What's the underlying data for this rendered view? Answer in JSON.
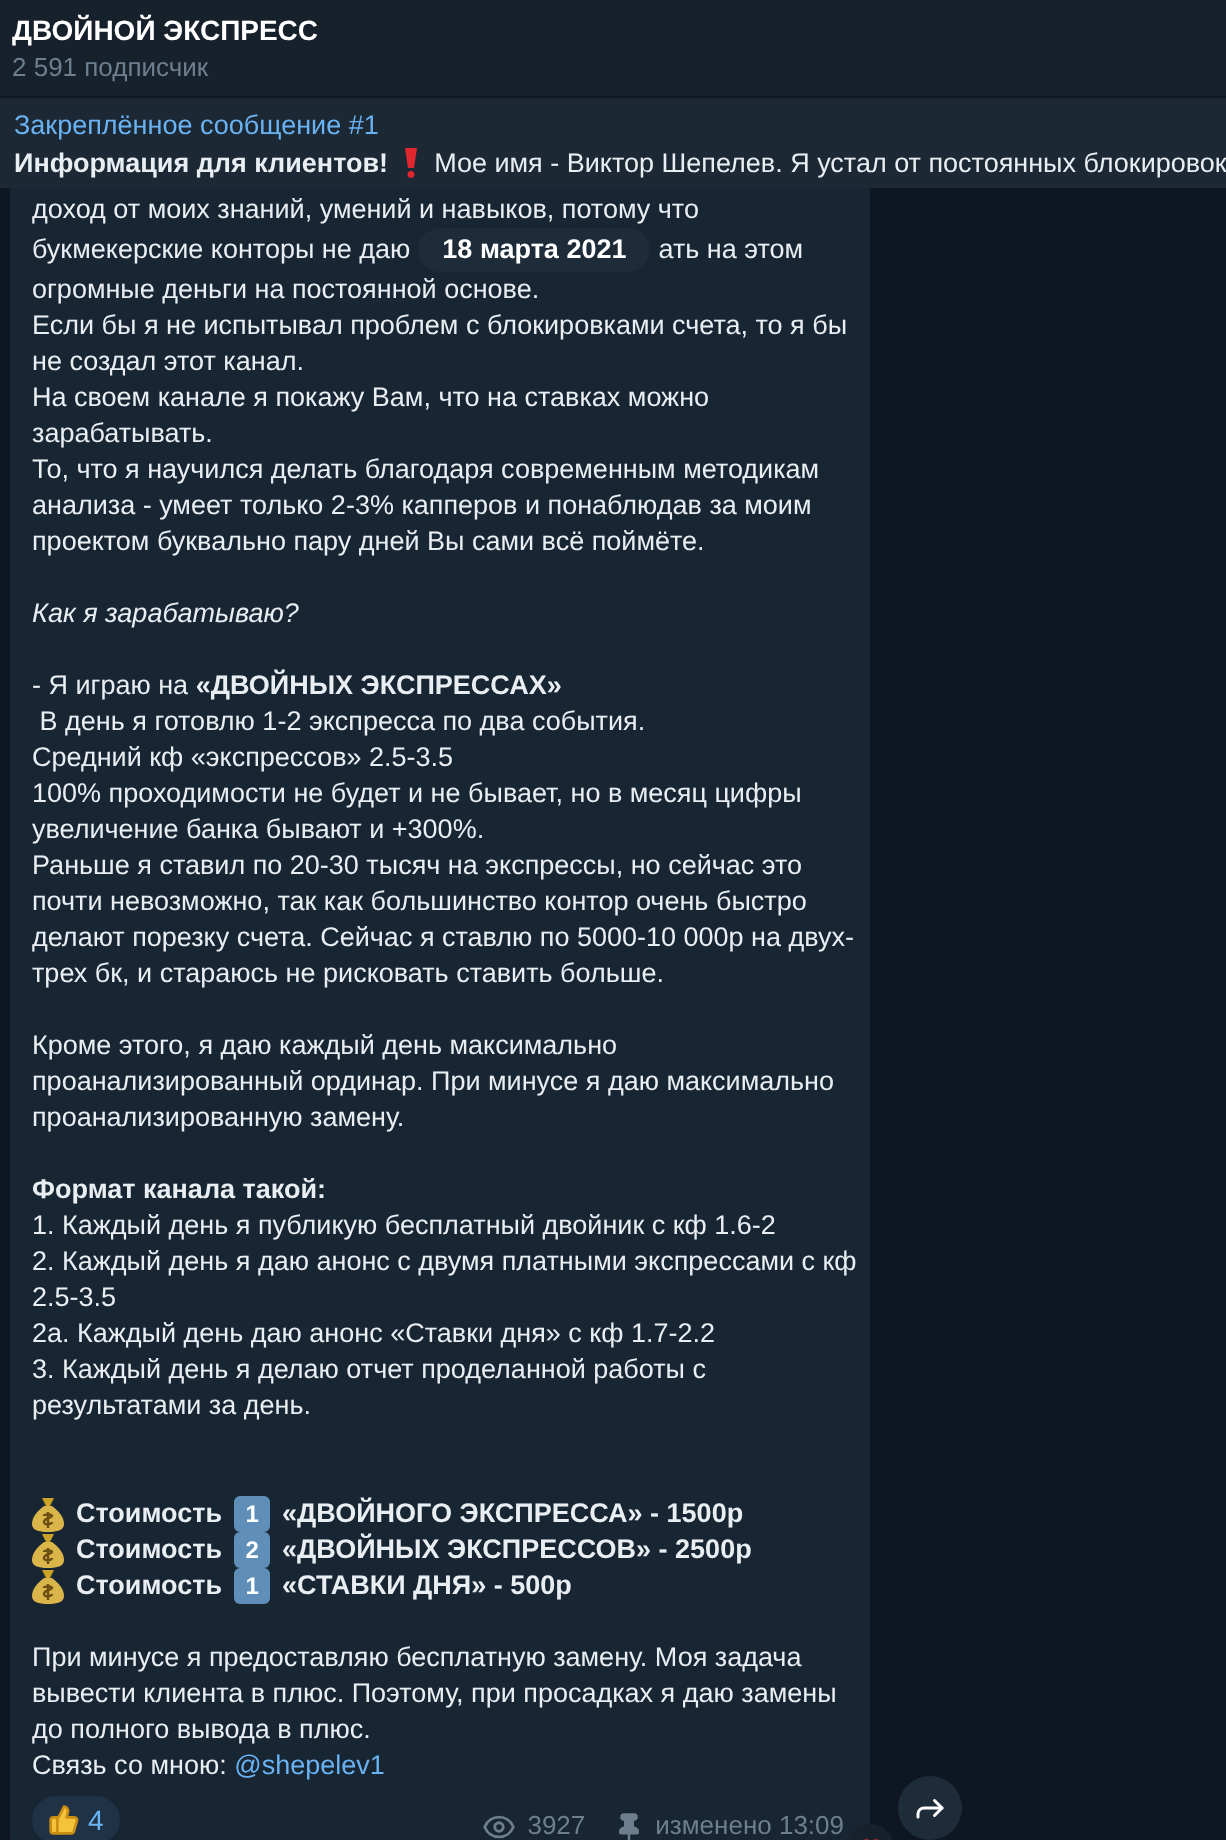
{
  "channel": {
    "title": "ДВОЙНОЙ ЭКСПРЕСС",
    "subscribers": "2 591 подписчик"
  },
  "pinned": {
    "title": "Закреплённое сообщение #1",
    "bold": "Информация для клиентов!",
    "text": "Мое имя - Виктор Шепелев.  Я устал от постоянных блокировок"
  },
  "message": {
    "blocks": [
      {
        "kind": "text",
        "text": "доход от моих знаний, умений и навыков, потому что"
      },
      {
        "kind": "split",
        "left": "букмекерские конторы не даю",
        "date": "18 марта 2021",
        "right": "ать на этом"
      },
      {
        "kind": "text",
        "text": "огромные деньги на постоянной основе.\nЕсли бы я не испытывал проблем с блокировками счета, то я бы\nне создал этот канал.\nНа своем канале я покажу Вам, что на ставках можно\nзарабатывать.\nТо, что я научился делать благодаря современным методикам\nанализа - умеет только 2-3% капперов и понаблюдав за моим\nпроектом буквально пару дней Вы сами всё поймёте."
      },
      {
        "kind": "gap"
      },
      {
        "kind": "italic",
        "text": "Как я зарабатываю?"
      },
      {
        "kind": "gap"
      },
      {
        "kind": "text",
        "text": "- Я играю на **«ДВОЙНЫХ ЭКСПРЕССАХ»**\n В день я готовлю 1-2 экспресса по два события.\nСредний кф «экспрессов» 2.5-3.5\n100% проходимости не будет и не бывает, но в месяц цифры\nувеличение банка бывают и +300%.\nРаньше я ставил по 20-30 тысяч на экспрессы, но сейчас это\nпочти невозможно, так как большинство контор очень быстро\nделают порезку счета. Сейчас я ставлю по 5000-10 000р на двух-\nтрех бк, и стараюсь не рисковать ставить больше."
      },
      {
        "kind": "gap"
      },
      {
        "kind": "text",
        "text": "Кроме этого, я даю каждый день максимально\nпроанализированный ординар. При минусе я даю максимально\nпроанализированную замену."
      },
      {
        "kind": "gap"
      },
      {
        "kind": "bold",
        "text": "Формат канала такой:"
      },
      {
        "kind": "text",
        "text": "1. Каждый день я публикую бесплатный двойник с кф 1.6-2\n2. Каждый день я даю анонс с двумя платными экспрессами с кф\n2.5-3.5\n2а. Каждый день даю анонс «Ставки дня» с кф 1.7-2.2\n3. Каждый день я делаю отчет проделанной работы с\nрезультатами за день."
      },
      {
        "kind": "gap"
      },
      {
        "kind": "gap"
      },
      {
        "kind": "price",
        "label": "Стоимость",
        "number": "1",
        "name": "«ДВОЙНОГО ЭКСПРЕССА» - 1500р"
      },
      {
        "kind": "price",
        "label": "Стоимость",
        "number": "2",
        "name": "«ДВОЙНЫХ ЭКСПРЕССОВ» - 2500р"
      },
      {
        "kind": "price",
        "label": "Стоимость",
        "number": "1",
        "name": "«СТАВКИ ДНЯ» - 500р"
      },
      {
        "kind": "gap"
      },
      {
        "kind": "text",
        "text": "При минусе я предоставляю бесплатную замену. Моя задача\nвывести клиента в плюс. Поэтому, при просадках я даю замены\nдо полного вывода в плюс."
      },
      {
        "kind": "contact",
        "text": "Связь со мною:",
        "link": "@shepelev1"
      }
    ],
    "reaction_count": "4",
    "views": "3927",
    "edited": "изменено 13:09"
  }
}
